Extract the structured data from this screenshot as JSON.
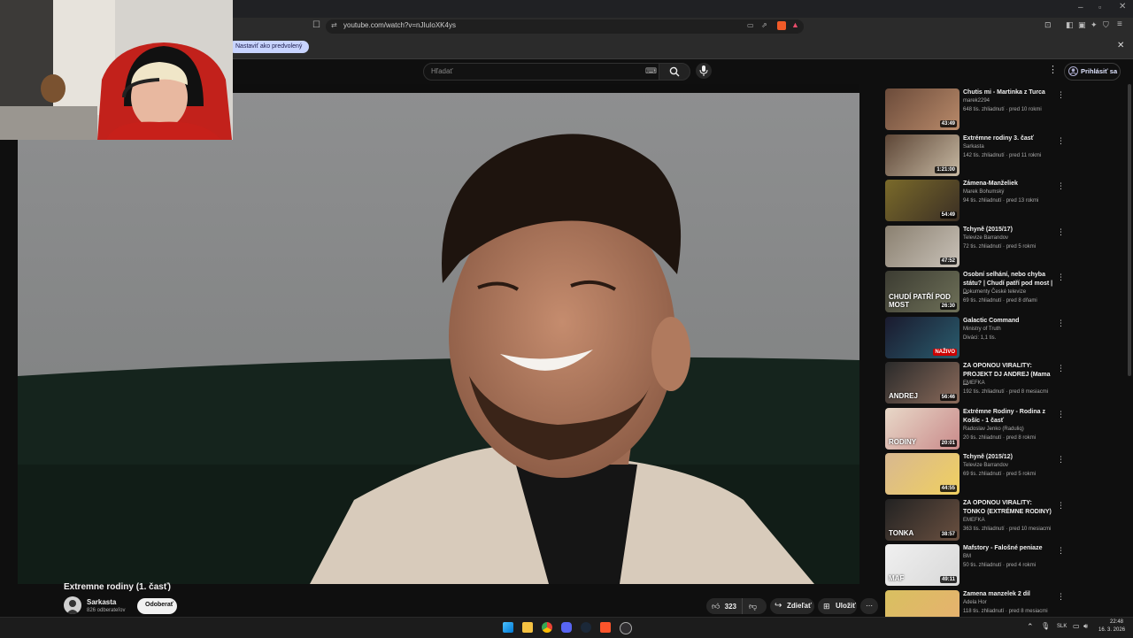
{
  "browser": {
    "url": "youtube.com/watch?v=nJIuIoXK4ys",
    "infobar_chip": "Nastaviť ako predvolený"
  },
  "header": {
    "search_placeholder": "Hľadať",
    "signin_label": "Prihlásiť sa"
  },
  "video": {
    "title": "Extremne rodiny (1. časť)",
    "channel": "Sarkasta",
    "subscribers": "826 odberateľov",
    "subscribe_label": "Odoberať",
    "likes": "323",
    "share_label": "Zdieľať",
    "save_label": "Uložiť"
  },
  "sidebar": {
    "items": [
      {
        "title": "Chutis mi - Martinka z Turca",
        "channel": "marek2294",
        "stats": "648 tis. zhliadnutí · pred 10 rokmi",
        "duration": "43:49",
        "colors": [
          "#6b4b3a",
          "#b98a6a"
        ]
      },
      {
        "title": "Extrémne rodiny 3. časť",
        "channel": "Sarkasta",
        "stats": "142 tis. zhliadnutí · pred 11 rokmi",
        "duration": "1:21:00",
        "colors": [
          "#5d4636",
          "#c7b9a3"
        ]
      },
      {
        "title": "Zámena-Manželiek",
        "channel": "Marek Bohumský",
        "stats": "94 tis. zhliadnutí · pred 13 rokmi",
        "duration": "54:49",
        "colors": [
          "#7a6a2a",
          "#3b2f24"
        ]
      },
      {
        "title": "Tchyně (2015/17)",
        "channel": "Televize Barrandov",
        "stats": "72 tis. zhliadnutí · pred 5 rokmi",
        "duration": "47:52",
        "colors": [
          "#8a8070",
          "#c9c2b8"
        ]
      },
      {
        "title": "Osobní selhání, nebo chyba státu? | Chudí patří pod most | ...",
        "channel": "Dokumenty České televize",
        "stats": "69 tis. zhliadnutí · pred 8 dňami",
        "duration": "26:30",
        "colors": [
          "#3c3c32",
          "#6e7058"
        ],
        "overlay": "CHUDÍ PATŘÍ POD MOST"
      },
      {
        "title": "Galactic Command",
        "channel": "Ministry of Truth",
        "stats": "Diváci: 1,1 tis.",
        "live": "NAŽIVO",
        "colors": [
          "#1a1a2e",
          "#2a5d6e"
        ]
      },
      {
        "title": "ZA OPONOU VIRALITY: PROJEKT DJ ANDREJ (Mama ...",
        "channel": "EMEFKA",
        "stats": "192 tis. zhliadnutí · pred 8 mesiacmi",
        "duration": "56:46",
        "colors": [
          "#2a2a2a",
          "#8a6a5a"
        ],
        "overlay": "ANDREJ"
      },
      {
        "title": "Extrémne Rodiny - Rodina z Košíc - 1 časť",
        "channel": "Radoslav Jenko (Raduliq)",
        "stats": "20 tis. zhliadnutí · pred 8 rokmi",
        "duration": "20:01",
        "colors": [
          "#e8d8c8",
          "#c98a8a"
        ],
        "overlay": "RODINY"
      },
      {
        "title": "Tchyně (2015/12)",
        "channel": "Televize Barrandov",
        "stats": "69 tis. zhliadnutí · pred 5 rokmi",
        "duration": "44:55",
        "colors": [
          "#d8b890",
          "#f0d060"
        ]
      },
      {
        "title": "ZA OPONOU VIRALITY: TONKO (EXTRÉMNE RODINY)",
        "channel": "EMEFKA",
        "stats": "363 tis. zhliadnutí · pred 10 mesiacmi",
        "duration": "38:57",
        "colors": [
          "#222222",
          "#6a5040"
        ],
        "overlay": "TONKA"
      },
      {
        "title": "Mafstory - Falošné peniaze",
        "channel": "BM",
        "stats": "50 tis. zhliadnutí · pred 4 rokmi",
        "duration": "49:11",
        "colors": [
          "#f0f0f0",
          "#d8d8d8"
        ],
        "overlay": "MAF"
      },
      {
        "title": "Zamena manzelek 2 dil",
        "channel": "Adela Hor",
        "stats": "118 tis. zhliadnutí · pred 8 mesiacmi",
        "colors": [
          "#d8c060",
          "#e8b070"
        ]
      }
    ]
  },
  "taskbar": {
    "lang": "SLK",
    "time": "22:48",
    "date": "16. 3. 2026"
  }
}
